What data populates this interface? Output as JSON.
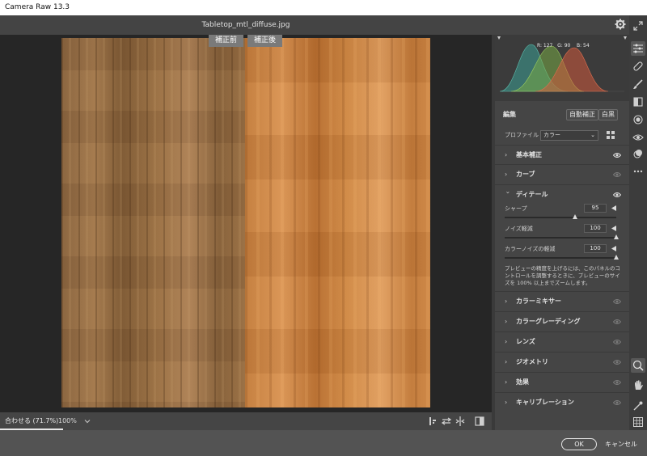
{
  "window": {
    "title": "Camera Raw 13.3"
  },
  "document": {
    "filename": "Tabletop_mtl_diffuse.jpg"
  },
  "compare": {
    "before_label": "補正前",
    "after_label": "補正後"
  },
  "statusbar": {
    "fit_label": "合わせる (71.7%)",
    "zoom_value": "100%"
  },
  "histogram": {
    "r_label": "R: 127",
    "g_label": "G: 90",
    "b_label": "B: 54"
  },
  "edit": {
    "title": "編集",
    "auto_button": "自動補正",
    "bw_button": "白黒",
    "profile_label": "プロファイル",
    "profile_value": "カラー"
  },
  "sections": [
    {
      "label": "基本補正",
      "expanded": false
    },
    {
      "label": "カーブ",
      "expanded": false
    },
    {
      "label": "ディテール",
      "expanded": true
    },
    {
      "label": "カラーミキサー",
      "expanded": false
    },
    {
      "label": "カラーグレーディング",
      "expanded": false
    },
    {
      "label": "レンズ",
      "expanded": false
    },
    {
      "label": "ジオメトリ",
      "expanded": false
    },
    {
      "label": "効果",
      "expanded": false
    },
    {
      "label": "キャリブレーション",
      "expanded": false
    }
  ],
  "detail": {
    "sliders": [
      {
        "label": "シャープ",
        "value": "95",
        "fraction": 0.63
      },
      {
        "label": "ノイズ軽減",
        "value": "100",
        "fraction": 1.0
      },
      {
        "label": "カラーノイズの軽減",
        "value": "100",
        "fraction": 1.0
      }
    ],
    "note": "プレビューの精度を上げるには、このパネルのコントロールを調整するときに、プレビューのサイズを 100% 以上までズームします。"
  },
  "footer": {
    "ok_label": "OK",
    "cancel_label": "キャンセル"
  },
  "colors": {
    "panel_bg": "#454545",
    "canvas_bg": "#262626",
    "accent": "#ffffff"
  }
}
